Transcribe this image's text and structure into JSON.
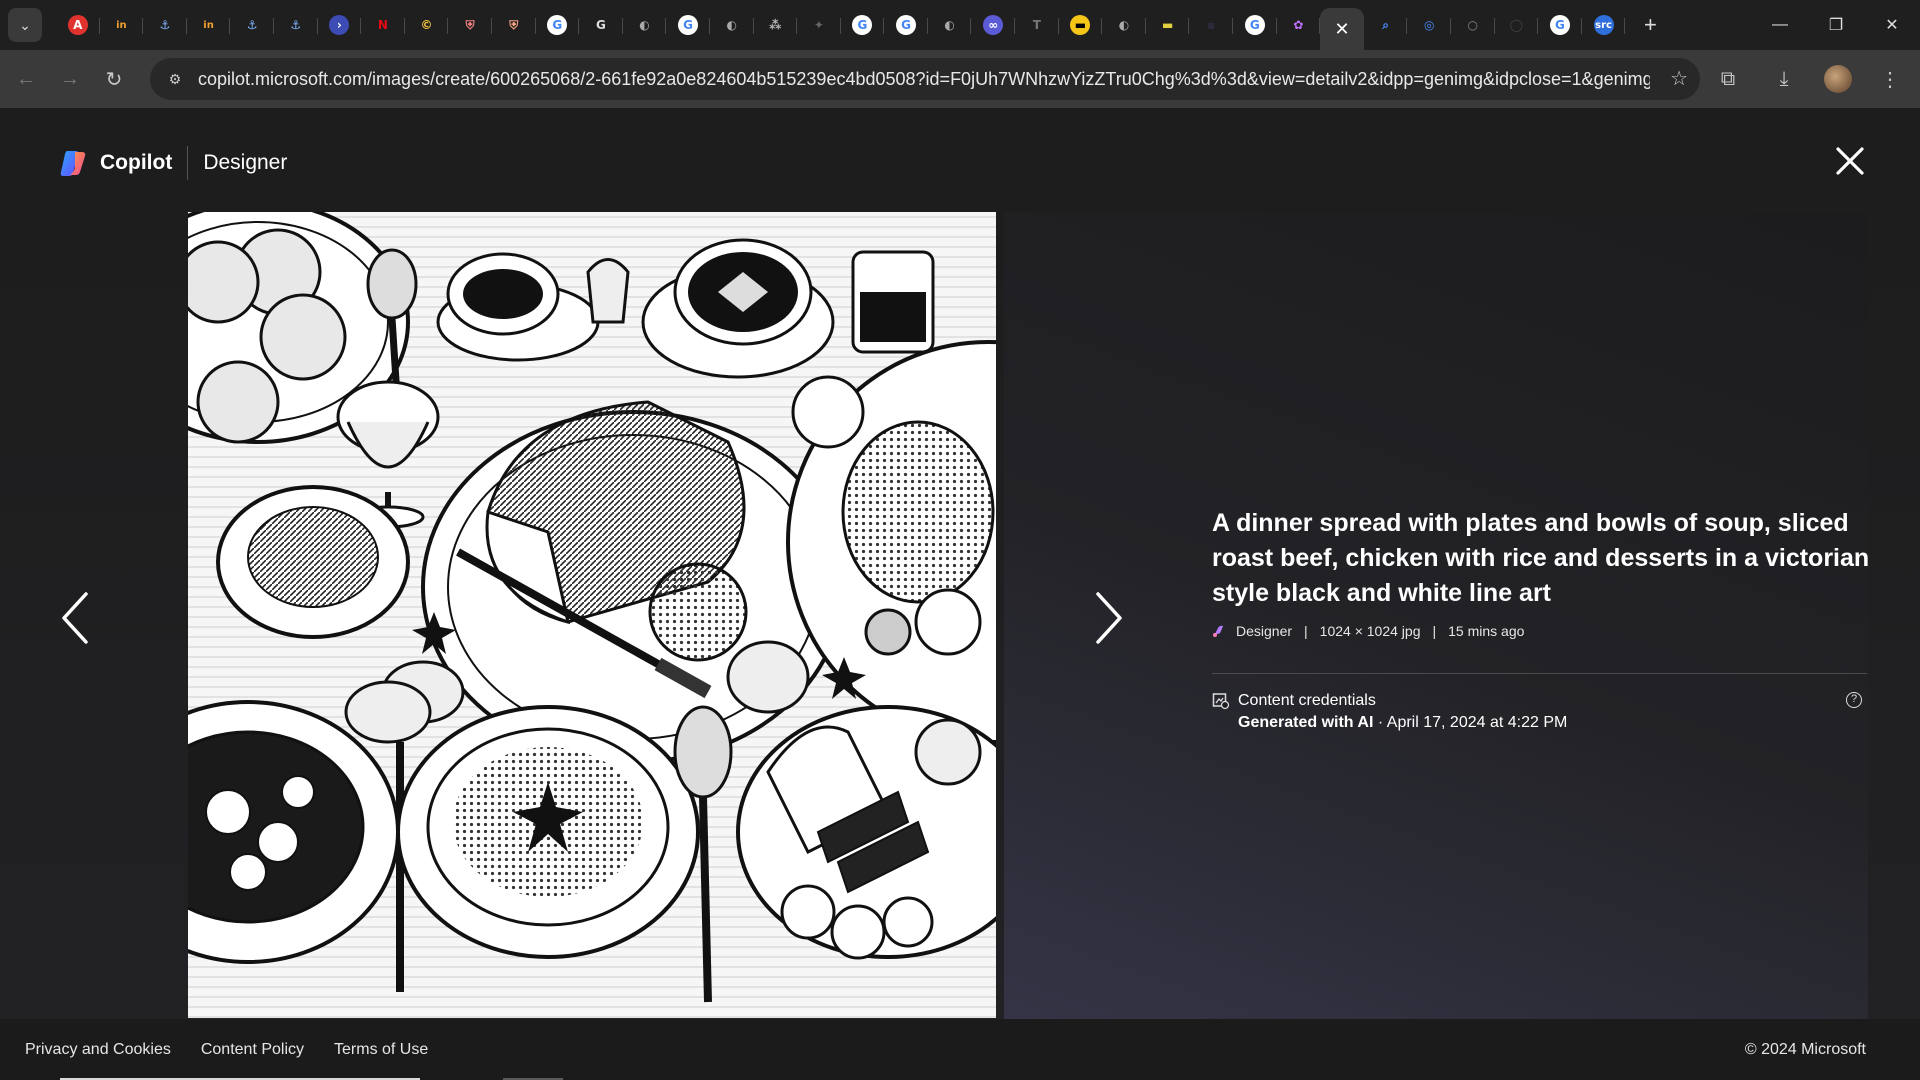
{
  "browser": {
    "tabs": [
      {
        "icon": "adobe-icon",
        "glyph": "A",
        "bg": "#e0332d",
        "fg": "#fff"
      },
      {
        "icon": "in-icon",
        "glyph": "in",
        "bg": "transparent",
        "fg": "#f0a030"
      },
      {
        "icon": "anchor-icon",
        "glyph": "⚓",
        "bg": "transparent",
        "fg": "#7fb6ff"
      },
      {
        "icon": "in-icon",
        "glyph": "in",
        "bg": "transparent",
        "fg": "#f0a030"
      },
      {
        "icon": "anchor-icon",
        "glyph": "⚓",
        "bg": "transparent",
        "fg": "#7fb6ff"
      },
      {
        "icon": "anchor-icon",
        "glyph": "⚓",
        "bg": "transparent",
        "fg": "#7fb6ff"
      },
      {
        "icon": "powershell-icon",
        "glyph": "›",
        "bg": "#3d4bb5",
        "fg": "#fff"
      },
      {
        "icon": "netflix-icon",
        "glyph": "N",
        "bg": "transparent",
        "fg": "#e50914"
      },
      {
        "icon": "copyright-icon",
        "glyph": "©",
        "bg": "transparent",
        "fg": "#f3c23b"
      },
      {
        "icon": "shield-icon",
        "glyph": "⛨",
        "bg": "transparent",
        "fg": "#f08080"
      },
      {
        "icon": "shield-icon",
        "glyph": "⛨",
        "bg": "transparent",
        "fg": "#f0a080"
      },
      {
        "icon": "google-icon",
        "glyph": "G",
        "bg": "#fff",
        "fg": "#4285f4"
      },
      {
        "icon": "g-icon",
        "glyph": "G",
        "bg": "transparent",
        "fg": "#ddd"
      },
      {
        "icon": "globe-icon",
        "glyph": "◐",
        "bg": "transparent",
        "fg": "#aaa"
      },
      {
        "icon": "google-icon",
        "glyph": "G",
        "bg": "#fff",
        "fg": "#4285f4"
      },
      {
        "icon": "globe-icon",
        "glyph": "◐",
        "bg": "transparent",
        "fg": "#aaa"
      },
      {
        "icon": "dots-icon",
        "glyph": "⁂",
        "bg": "transparent",
        "fg": "#bbb"
      },
      {
        "icon": "puzzle-icon",
        "glyph": "✦",
        "bg": "transparent",
        "fg": "#666"
      },
      {
        "icon": "google-icon",
        "glyph": "G",
        "bg": "#fff",
        "fg": "#4285f4"
      },
      {
        "icon": "google-icon",
        "glyph": "G",
        "bg": "#fff",
        "fg": "#4285f4"
      },
      {
        "icon": "globe-icon",
        "glyph": "◐",
        "bg": "transparent",
        "fg": "#aaa"
      },
      {
        "icon": "link-icon",
        "glyph": "∞",
        "bg": "#5b5bd6",
        "fg": "#fff"
      },
      {
        "icon": "t-icon",
        "glyph": "T",
        "bg": "transparent",
        "fg": "#777"
      },
      {
        "icon": "imdb-icon",
        "glyph": "▬",
        "bg": "#f5c518",
        "fg": "#000"
      },
      {
        "icon": "globe-icon",
        "glyph": "◐",
        "bg": "transparent",
        "fg": "#aaa"
      },
      {
        "icon": "bar-icon",
        "glyph": "▬",
        "bg": "transparent",
        "fg": "#e0d040"
      },
      {
        "icon": "dark-icon",
        "glyph": "▪",
        "bg": "transparent",
        "fg": "#2a2a3a"
      },
      {
        "icon": "google-icon",
        "glyph": "G",
        "bg": "#fff",
        "fg": "#4285f4"
      },
      {
        "icon": "copilot-icon",
        "glyph": "✿",
        "bg": "transparent",
        "fg": "#c070ff"
      },
      {
        "icon": "close-icon",
        "glyph": "✕",
        "bg": "transparent",
        "fg": "#fff",
        "active": true
      },
      {
        "icon": "search-icon",
        "glyph": "⌕",
        "bg": "transparent",
        "fg": "#4a8cff"
      },
      {
        "icon": "lens-icon",
        "glyph": "◎",
        "bg": "transparent",
        "fg": "#4a8cff"
      },
      {
        "icon": "circle-icon",
        "glyph": "○",
        "bg": "transparent",
        "fg": "#888"
      },
      {
        "icon": "github-icon",
        "glyph": "◯",
        "bg": "transparent",
        "fg": "#444"
      },
      {
        "icon": "google-icon",
        "glyph": "G",
        "bg": "#fff",
        "fg": "#4285f4"
      },
      {
        "icon": "src-icon",
        "glyph": "src",
        "bg": "#2f6fdb",
        "fg": "#fff"
      }
    ],
    "url": "copilot.microsoft.com/images/create/600265068/2-661fe92a0e824604b515239ec4bd0508?id=F0jUh7WNhzwYizZTru0Chg%3d%3d&view=detailv2&idpp=genimg&idpclose=1&genimgbc..."
  },
  "header": {
    "brand": "Copilot",
    "product": "Designer"
  },
  "details": {
    "title": "A dinner spread with plates and bowls of soup, sliced roast beef, chicken with rice and desserts in a victorian style black and white line art",
    "source": "Designer",
    "dimensions": "1024 × 1024 jpg",
    "age": "15 mins ago",
    "sep": "|",
    "credentials_label": "Content credentials",
    "credentials_generated": "Generated with AI",
    "credentials_date": " · April 17, 2024 at 4:22 PM",
    "help": "?"
  },
  "footer": {
    "links": [
      "Privacy and Cookies",
      "Content Policy",
      "Terms of Use"
    ],
    "copyright": "© 2024 Microsoft"
  },
  "colors": {
    "page_bg": "#1d1d1d",
    "panel_gradient_end": "#343446"
  }
}
